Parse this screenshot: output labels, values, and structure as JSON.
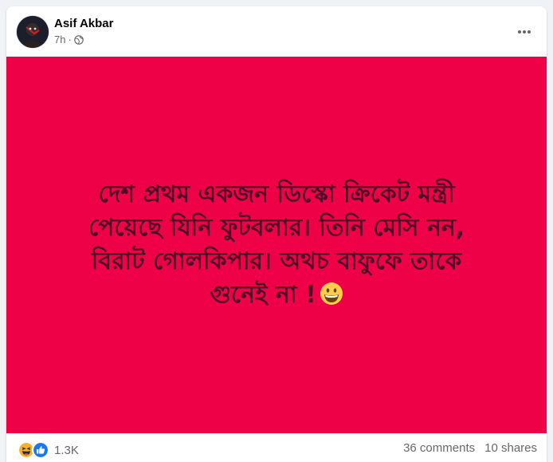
{
  "post": {
    "author": "Asif Akbar",
    "time": "7h",
    "separator": "·",
    "privacy_icon": "globe-icon",
    "more_icon": "more-horizontal-icon",
    "background_color": "#ef0148",
    "text_color": "#4e0a26",
    "text_lines": [
      "দেশ প্রথম একজন ডিস্কো ক্রিকেট মন্ত্রী",
      "পেয়েছে যিনি ফুটবলার। তিনি মেসি নন,",
      "বিরাট গোলকিপার। অথচ বাফুফে তাকে",
      "গুনেই না !"
    ],
    "text_emoji": "grinning-face-icon"
  },
  "footer": {
    "reaction_icons": [
      "haha-reaction-icon",
      "like-reaction-icon"
    ],
    "reaction_count": "1.3K",
    "comments": "36 comments",
    "shares": "10 shares"
  }
}
